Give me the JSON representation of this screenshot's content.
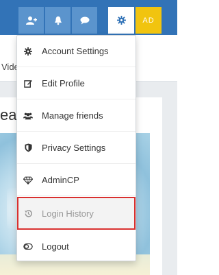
{
  "header": {
    "avatar_initials": "AD",
    "colors": {
      "bar": "#3273b7",
      "button": "#5b94cd",
      "avatar": "#f1c40f"
    },
    "icons": [
      "add-user-icon",
      "bell-icon",
      "chat-icon",
      "gear-icon"
    ]
  },
  "subnav": {
    "partial_text": "Vide"
  },
  "card": {
    "partial_heading": "eat"
  },
  "dropdown": {
    "items": [
      {
        "label": "Account Settings",
        "icon": "gear-icon"
      },
      {
        "label": "Edit Profile",
        "icon": "edit-icon"
      },
      {
        "label": "Manage friends",
        "icon": "users-icon"
      },
      {
        "label": "Privacy Settings",
        "icon": "shield-icon"
      },
      {
        "label": "AdminCP",
        "icon": "diamond-icon"
      },
      {
        "label": "Login History",
        "icon": "history-icon"
      },
      {
        "label": "Logout",
        "icon": "toggle-icon"
      }
    ],
    "highlight_color": "#d9302f"
  }
}
